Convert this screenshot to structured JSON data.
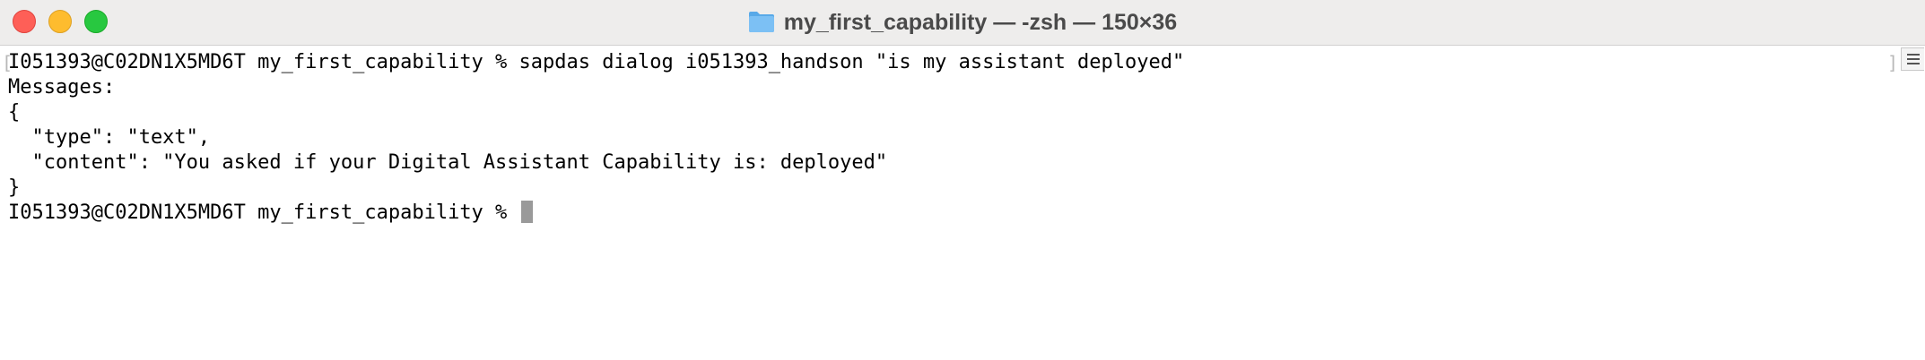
{
  "window": {
    "title": "my_first_capability — -zsh — 150×36",
    "folder_icon": "folder-icon",
    "traffic_lights": {
      "close": "#fe5f57",
      "minimize": "#febc2e",
      "zoom": "#28c840"
    }
  },
  "terminal": {
    "lines": [
      "I051393@C02DN1X5MD6T my_first_capability % sapdas dialog i051393_handson \"is my assistant deployed\"",
      "Messages:",
      "{",
      "  \"type\": \"text\",",
      "  \"content\": \"You asked if your Digital Assistant Capability is: deployed\"",
      "}"
    ],
    "prompt": "I051393@C02DN1X5MD6T my_first_capability % ",
    "mark_left": "[",
    "mark_right": "]",
    "cursor_color": "#9a9a9a"
  },
  "marks_button_icon": "list-icon"
}
